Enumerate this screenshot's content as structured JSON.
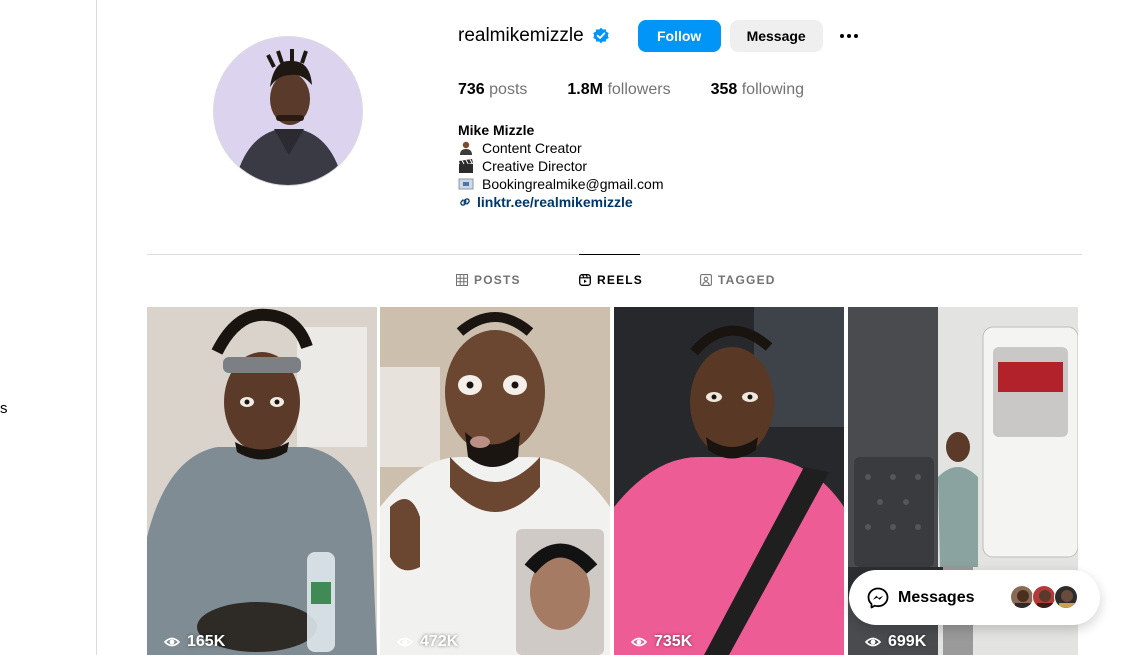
{
  "sidebar": {
    "fragment": "s"
  },
  "profile": {
    "username": "realmikemizzle",
    "verified": true,
    "follow_label": "Follow",
    "message_label": "Message",
    "stats": {
      "posts_num": "736",
      "posts_label": "posts",
      "followers_num": "1.8M",
      "followers_label": "followers",
      "following_num": "358",
      "following_label": "following"
    },
    "bio": {
      "name": "Mike Mizzle",
      "line1": "Content Creator",
      "line2": "Creative Director",
      "line3": "Bookingrealmike@gmail.com",
      "link": "linktr.ee/realmikemizzle"
    }
  },
  "tabs": [
    {
      "label": "POSTS",
      "icon": "grid-icon",
      "active": false
    },
    {
      "label": "REELS",
      "icon": "reels-icon",
      "active": true
    },
    {
      "label": "TAGGED",
      "icon": "tagged-icon",
      "active": false
    }
  ],
  "reels": [
    {
      "views": "165K"
    },
    {
      "views": "472K"
    },
    {
      "views": "735K"
    },
    {
      "views": "699K"
    }
  ],
  "messages": {
    "label": "Messages"
  },
  "colors": {
    "accent": "#0095f6",
    "link": "#00376b",
    "verified": "#0095f6"
  }
}
